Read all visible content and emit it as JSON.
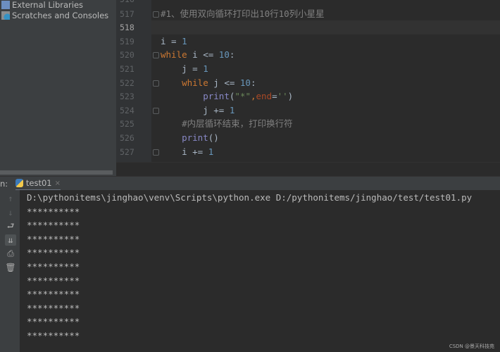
{
  "sidebar": {
    "items": [
      {
        "label": "External Libraries",
        "icon": "library-icon"
      },
      {
        "label": "Scratches and Consoles",
        "icon": "scratches-icon"
      }
    ]
  },
  "editor": {
    "first_partial_line": "516",
    "current_line": "518",
    "lines": [
      {
        "n": "517",
        "fold": true,
        "tokens": [
          {
            "t": "#1、使用双向循环打印出10行10列小星星",
            "c": "cm"
          }
        ]
      },
      {
        "n": "518",
        "tokens": []
      },
      {
        "n": "519",
        "tokens": [
          {
            "t": "i = ",
            "c": ""
          },
          {
            "t": "1",
            "c": "num"
          }
        ]
      },
      {
        "n": "520",
        "fold": true,
        "tokens": [
          {
            "t": "while",
            "c": "kw"
          },
          {
            "t": " i <= ",
            "c": ""
          },
          {
            "t": "10",
            "c": "num"
          },
          {
            "t": ":",
            "c": ""
          }
        ]
      },
      {
        "n": "521",
        "tokens": [
          {
            "t": "    j = ",
            "c": ""
          },
          {
            "t": "1",
            "c": "num"
          }
        ]
      },
      {
        "n": "522",
        "fold": true,
        "tokens": [
          {
            "t": "    ",
            "c": ""
          },
          {
            "t": "while",
            "c": "kw"
          },
          {
            "t": " j <= ",
            "c": ""
          },
          {
            "t": "10",
            "c": "num"
          },
          {
            "t": ":",
            "c": ""
          }
        ]
      },
      {
        "n": "523",
        "tokens": [
          {
            "t": "        ",
            "c": ""
          },
          {
            "t": "print",
            "c": "fn"
          },
          {
            "t": "(",
            "c": ""
          },
          {
            "t": "\"*\"",
            "c": "str"
          },
          {
            "t": ",",
            "c": "kw"
          },
          {
            "t": "end",
            "c": "kwa"
          },
          {
            "t": "=",
            "c": ""
          },
          {
            "t": "''",
            "c": "str"
          },
          {
            "t": ")",
            "c": ""
          }
        ]
      },
      {
        "n": "524",
        "fold": true,
        "tokens": [
          {
            "t": "        j += ",
            "c": ""
          },
          {
            "t": "1",
            "c": "num"
          }
        ]
      },
      {
        "n": "525",
        "tokens": [
          {
            "t": "    ",
            "c": ""
          },
          {
            "t": "#内层循环结束，打印换行符",
            "c": "cm"
          }
        ]
      },
      {
        "n": "526",
        "tokens": [
          {
            "t": "    ",
            "c": ""
          },
          {
            "t": "print",
            "c": "fn"
          },
          {
            "t": "()",
            "c": ""
          }
        ]
      },
      {
        "n": "527",
        "fold": true,
        "tokens": [
          {
            "t": "    i += ",
            "c": ""
          },
          {
            "t": "1",
            "c": "num"
          }
        ]
      }
    ]
  },
  "run": {
    "label": "n:",
    "tab": "test01",
    "close": "×"
  },
  "toolbar": [
    {
      "icon": "arrow-up-icon",
      "glyph": "↑",
      "dim": true
    },
    {
      "icon": "arrow-down-icon",
      "glyph": "↓",
      "dim": true
    },
    {
      "icon": "soft-wrap-icon",
      "glyph": "⮐"
    },
    {
      "icon": "scroll-to-end-icon",
      "glyph": "⇊",
      "active": true
    },
    {
      "icon": "print-icon",
      "glyph": "⎙"
    },
    {
      "icon": "trash-icon",
      "glyph": "🗑"
    }
  ],
  "console": {
    "lines": [
      "D:\\pythonitems\\jinghao\\venv\\Scripts\\python.exe D:/pythonitems/jinghao/test/test01.py",
      "**********",
      "**********",
      "**********",
      "**********",
      "**********",
      "**********",
      "**********",
      "**********",
      "**********",
      "**********"
    ]
  },
  "watermark": "CSDN @景天科技苑"
}
